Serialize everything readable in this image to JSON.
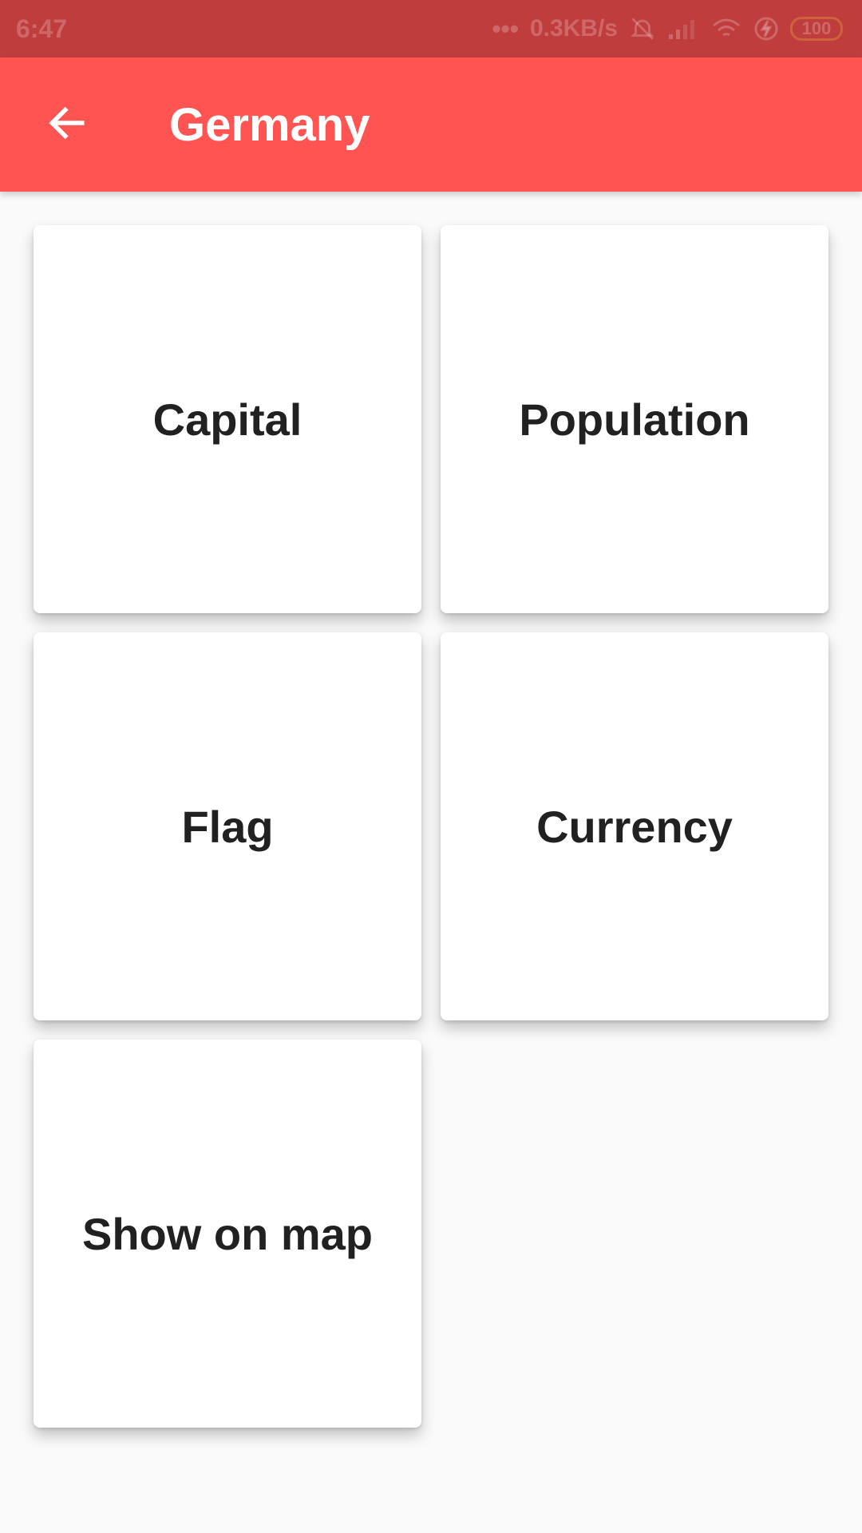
{
  "status_bar": {
    "time": "6:47",
    "dots": "•••",
    "network_speed": "0.3KB/s",
    "battery": "100"
  },
  "app_bar": {
    "title": "Germany",
    "back_icon": "arrow-left-icon"
  },
  "colors": {
    "status_bar": "#c03d3d",
    "app_bar": "#ff5452",
    "background": "#fafafa",
    "tile": "#ffffff",
    "tile_text": "#212121"
  },
  "tiles": [
    {
      "label": "Capital"
    },
    {
      "label": "Population"
    },
    {
      "label": "Flag"
    },
    {
      "label": "Currency"
    },
    {
      "label": "Show on map"
    }
  ]
}
